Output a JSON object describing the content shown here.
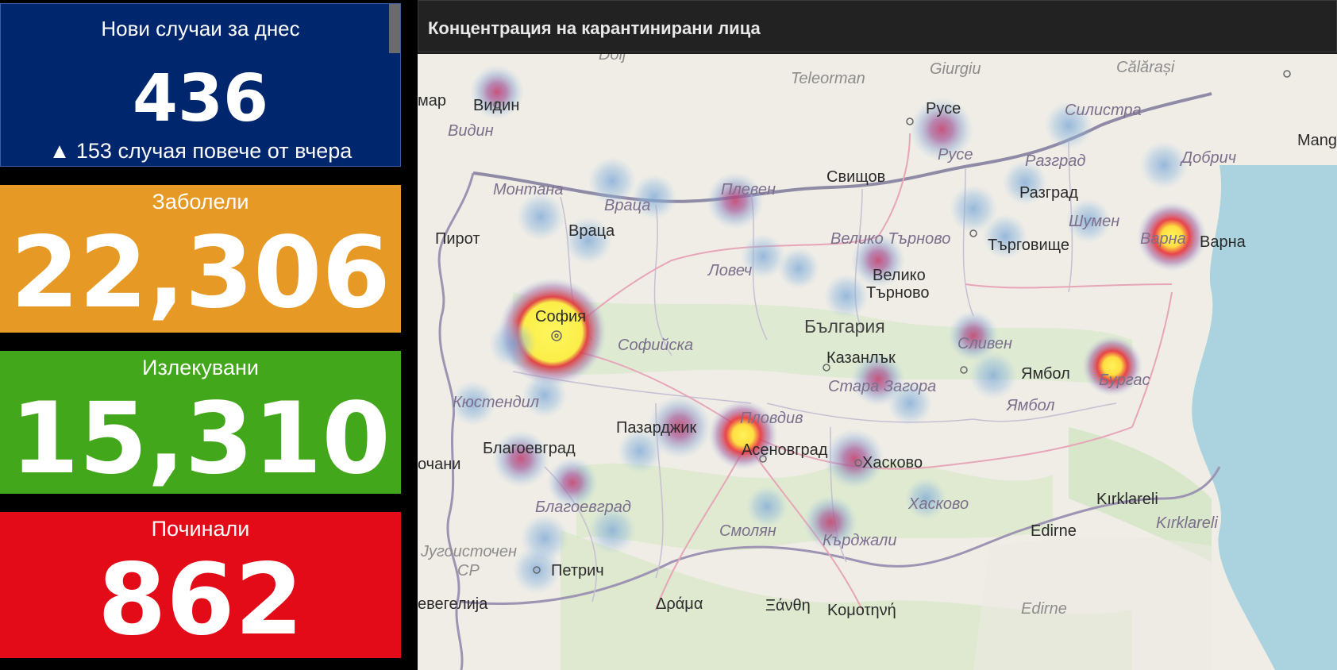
{
  "today": {
    "title": "Нови случаи за днес",
    "value": "436",
    "delta": "▲ 153 случая повече от вчера"
  },
  "cases": {
    "title": "Заболели",
    "value": "22,306"
  },
  "recovered": {
    "title": "Излекувани",
    "value": "15,310"
  },
  "deaths": {
    "title": "Починали",
    "value": "862"
  },
  "map": {
    "title": "Концентрация на карантинирани лица",
    "labels": {
      "dolj": "Dolj",
      "teleorman": "Teleorman",
      "giurgiu": "Giurgiu",
      "calarasi": "Călărași",
      "vidin_city": "Видин",
      "vidin_prov": "Видин",
      "ruse_city": "Русе",
      "ruse_prov": "Русе",
      "silistra": "Силистра",
      "mangalia": "Manga",
      "dobrich": "Добрич",
      "razgrad_prov": "Разград",
      "razgrad_city": "Разград",
      "svishtov": "Свищов",
      "montana": "Монтана",
      "vratsa_prov": "Враца",
      "vratsa_city": "Враца",
      "pleven": "Плевен",
      "shumen": "Шумен",
      "varna_prov": "Варна",
      "varna_city": "Варна",
      "pirot": "Пирот",
      "veliko_prov": "Велико Търново",
      "targovishte": "Търговище",
      "lovech": "Ловеч",
      "veliko_city_1": "Велико",
      "veliko_city_2": "Търново",
      "sofia_city": "София",
      "bulgaria": "България",
      "sofiyska": "Софийска",
      "sliven": "Сливен",
      "kazanlak": "Казанлък",
      "yambol_city": "Ямбол",
      "burgas": "Бургас",
      "stara_zagora": "Стара Загора",
      "yambol_prov": "Ямбол",
      "kyustendil": "Кюстендил",
      "plovdiv": "Пловдив",
      "pazardzhik": "Пазарджик",
      "blagoevgrad_city": "Благоевград",
      "asenovgrad": "Асеновград",
      "haskovo_city": "Хасково",
      "kirklareli_city": "Kırklareli",
      "blagoevgrad_prov": "Благоевград",
      "haskovo_prov": "Хасково",
      "kirklareli_prov": "Kırklareli",
      "smolyan": "Смолян",
      "edirne_city": "Edirne",
      "kardzhali": "Кърджали",
      "jugoistochen_1": "Југоисточен",
      "jugoistochen_2": "СР",
      "petrich": "Петрич",
      "nevegalija": "евегелија",
      "drama": "Δράμα",
      "xanthi": "Ξάνθη",
      "komotini": "Κομοτηνή",
      "edirne_prov": "Edirne",
      "mar": "мар",
      "ochani": "очани"
    }
  },
  "colors": {
    "today_bg": "#00266e",
    "cases_bg": "#e69a25",
    "recovered_bg": "#43a71b",
    "deaths_bg": "#e30b18",
    "map_header_bg": "#222222"
  }
}
